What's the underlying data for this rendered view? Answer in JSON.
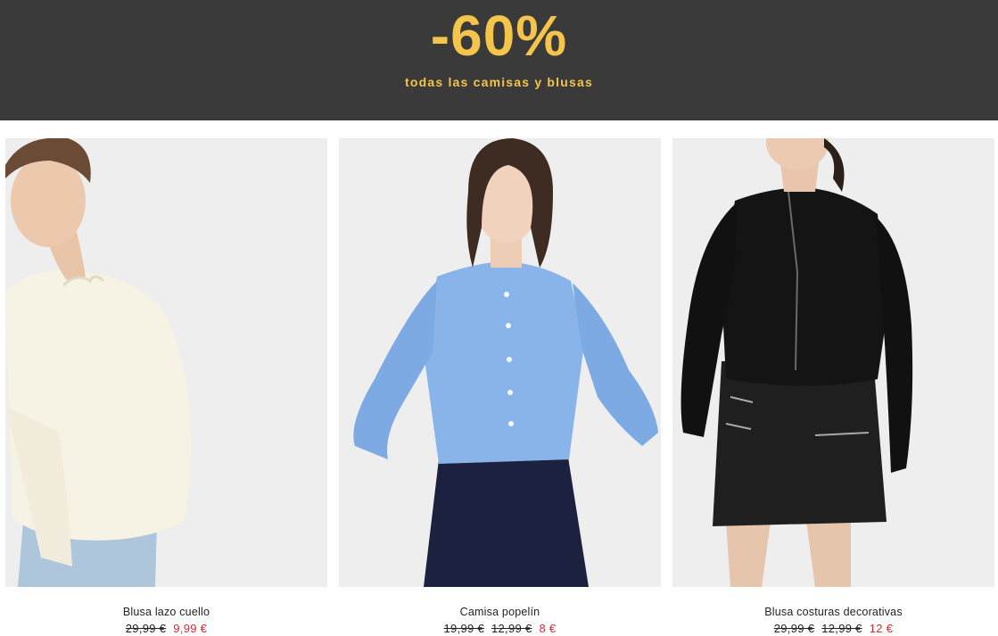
{
  "banner": {
    "discount": "-60%",
    "subtitle": "todas las camisas y blusas"
  },
  "colors": {
    "banner_bg": "#3a3a3a",
    "banner_text": "#f5c44a",
    "sale_price": "#e0262f",
    "photo_bg": "#eeeeee"
  },
  "products": [
    {
      "name": "Blusa lazo cuello",
      "old_prices": [
        "29,99 €"
      ],
      "sale_price": "9,99 €"
    },
    {
      "name": "Camisa popelín",
      "old_prices": [
        "19,99 €",
        "12,99 €"
      ],
      "sale_price": "8 €"
    },
    {
      "name": "Blusa costuras decorativas",
      "old_prices": [
        "29,99 €",
        "12,99 €"
      ],
      "sale_price": "12 €"
    }
  ]
}
